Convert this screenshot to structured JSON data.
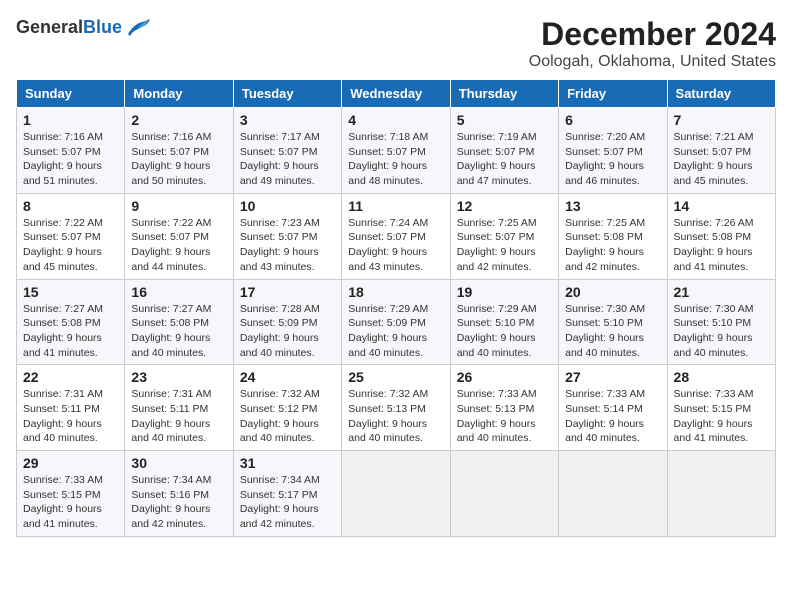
{
  "header": {
    "logo_general": "General",
    "logo_blue": "Blue",
    "title": "December 2024",
    "subtitle": "Oologah, Oklahoma, United States"
  },
  "weekdays": [
    "Sunday",
    "Monday",
    "Tuesday",
    "Wednesday",
    "Thursday",
    "Friday",
    "Saturday"
  ],
  "weeks": [
    [
      {
        "day": "1",
        "sunrise": "7:16 AM",
        "sunset": "5:07 PM",
        "daylight": "9 hours and 51 minutes."
      },
      {
        "day": "2",
        "sunrise": "7:16 AM",
        "sunset": "5:07 PM",
        "daylight": "9 hours and 50 minutes."
      },
      {
        "day": "3",
        "sunrise": "7:17 AM",
        "sunset": "5:07 PM",
        "daylight": "9 hours and 49 minutes."
      },
      {
        "day": "4",
        "sunrise": "7:18 AM",
        "sunset": "5:07 PM",
        "daylight": "9 hours and 48 minutes."
      },
      {
        "day": "5",
        "sunrise": "7:19 AM",
        "sunset": "5:07 PM",
        "daylight": "9 hours and 47 minutes."
      },
      {
        "day": "6",
        "sunrise": "7:20 AM",
        "sunset": "5:07 PM",
        "daylight": "9 hours and 46 minutes."
      },
      {
        "day": "7",
        "sunrise": "7:21 AM",
        "sunset": "5:07 PM",
        "daylight": "9 hours and 45 minutes."
      }
    ],
    [
      {
        "day": "8",
        "sunrise": "7:22 AM",
        "sunset": "5:07 PM",
        "daylight": "9 hours and 45 minutes."
      },
      {
        "day": "9",
        "sunrise": "7:22 AM",
        "sunset": "5:07 PM",
        "daylight": "9 hours and 44 minutes."
      },
      {
        "day": "10",
        "sunrise": "7:23 AM",
        "sunset": "5:07 PM",
        "daylight": "9 hours and 43 minutes."
      },
      {
        "day": "11",
        "sunrise": "7:24 AM",
        "sunset": "5:07 PM",
        "daylight": "9 hours and 43 minutes."
      },
      {
        "day": "12",
        "sunrise": "7:25 AM",
        "sunset": "5:07 PM",
        "daylight": "9 hours and 42 minutes."
      },
      {
        "day": "13",
        "sunrise": "7:25 AM",
        "sunset": "5:08 PM",
        "daylight": "9 hours and 42 minutes."
      },
      {
        "day": "14",
        "sunrise": "7:26 AM",
        "sunset": "5:08 PM",
        "daylight": "9 hours and 41 minutes."
      }
    ],
    [
      {
        "day": "15",
        "sunrise": "7:27 AM",
        "sunset": "5:08 PM",
        "daylight": "9 hours and 41 minutes."
      },
      {
        "day": "16",
        "sunrise": "7:27 AM",
        "sunset": "5:08 PM",
        "daylight": "9 hours and 40 minutes."
      },
      {
        "day": "17",
        "sunrise": "7:28 AM",
        "sunset": "5:09 PM",
        "daylight": "9 hours and 40 minutes."
      },
      {
        "day": "18",
        "sunrise": "7:29 AM",
        "sunset": "5:09 PM",
        "daylight": "9 hours and 40 minutes."
      },
      {
        "day": "19",
        "sunrise": "7:29 AM",
        "sunset": "5:10 PM",
        "daylight": "9 hours and 40 minutes."
      },
      {
        "day": "20",
        "sunrise": "7:30 AM",
        "sunset": "5:10 PM",
        "daylight": "9 hours and 40 minutes."
      },
      {
        "day": "21",
        "sunrise": "7:30 AM",
        "sunset": "5:10 PM",
        "daylight": "9 hours and 40 minutes."
      }
    ],
    [
      {
        "day": "22",
        "sunrise": "7:31 AM",
        "sunset": "5:11 PM",
        "daylight": "9 hours and 40 minutes."
      },
      {
        "day": "23",
        "sunrise": "7:31 AM",
        "sunset": "5:11 PM",
        "daylight": "9 hours and 40 minutes."
      },
      {
        "day": "24",
        "sunrise": "7:32 AM",
        "sunset": "5:12 PM",
        "daylight": "9 hours and 40 minutes."
      },
      {
        "day": "25",
        "sunrise": "7:32 AM",
        "sunset": "5:13 PM",
        "daylight": "9 hours and 40 minutes."
      },
      {
        "day": "26",
        "sunrise": "7:33 AM",
        "sunset": "5:13 PM",
        "daylight": "9 hours and 40 minutes."
      },
      {
        "day": "27",
        "sunrise": "7:33 AM",
        "sunset": "5:14 PM",
        "daylight": "9 hours and 40 minutes."
      },
      {
        "day": "28",
        "sunrise": "7:33 AM",
        "sunset": "5:15 PM",
        "daylight": "9 hours and 41 minutes."
      }
    ],
    [
      {
        "day": "29",
        "sunrise": "7:33 AM",
        "sunset": "5:15 PM",
        "daylight": "9 hours and 41 minutes."
      },
      {
        "day": "30",
        "sunrise": "7:34 AM",
        "sunset": "5:16 PM",
        "daylight": "9 hours and 42 minutes."
      },
      {
        "day": "31",
        "sunrise": "7:34 AM",
        "sunset": "5:17 PM",
        "daylight": "9 hours and 42 minutes."
      },
      null,
      null,
      null,
      null
    ]
  ],
  "labels": {
    "sunrise": "Sunrise:",
    "sunset": "Sunset:",
    "daylight": "Daylight:"
  }
}
